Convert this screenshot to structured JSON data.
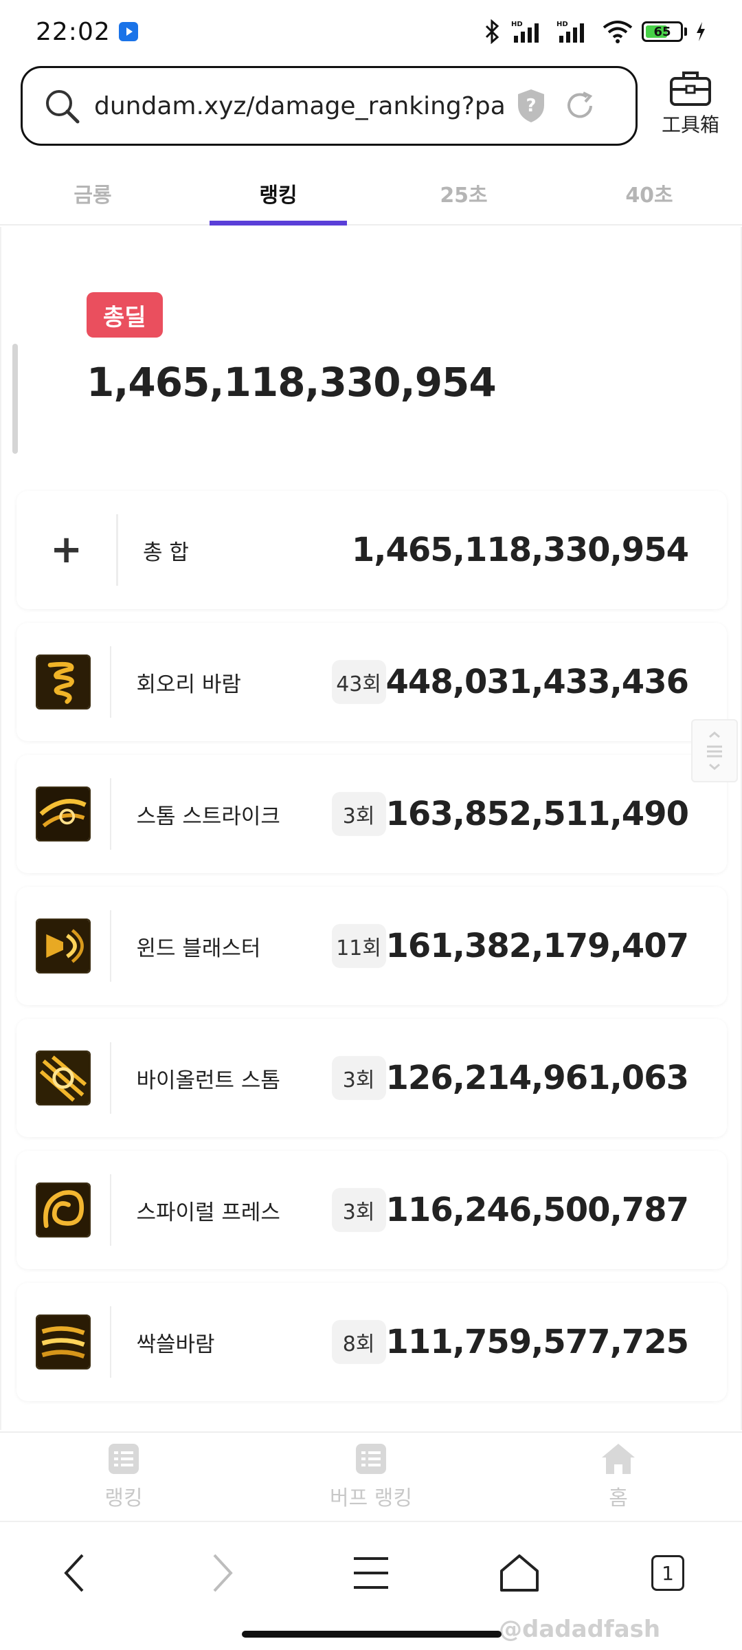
{
  "status_bar": {
    "time": "22:02",
    "battery": "65"
  },
  "browser": {
    "url": "dundam.xyz/damage_ranking?pa...",
    "toolbox_label": "工具箱"
  },
  "tabs": [
    {
      "label": "금룡",
      "active": false
    },
    {
      "label": "랭킹",
      "active": true
    },
    {
      "label": "25초",
      "active": false
    },
    {
      "label": "40초",
      "active": false
    }
  ],
  "summary": {
    "badge": "총딜",
    "total": "1,465,118,330,954"
  },
  "total_row": {
    "label": "총 합",
    "damage": "1,465,118,330,954"
  },
  "skills": [
    {
      "name": "회오리 바람",
      "count": "43회",
      "damage": "448,031,433,436",
      "icon": "whirlwind-skill-icon"
    },
    {
      "name": "스톰 스트라이크",
      "count": "3회",
      "damage": "163,852,511,490",
      "icon": "storm-strike-skill-icon"
    },
    {
      "name": "윈드 블래스터",
      "count": "11회",
      "damage": "161,382,179,407",
      "icon": "wind-blaster-skill-icon"
    },
    {
      "name": "바이올런트 스톰",
      "count": "3회",
      "damage": "126,214,961,063",
      "icon": "violent-storm-skill-icon"
    },
    {
      "name": "스파이럴 프레스",
      "count": "3회",
      "damage": "116,246,500,787",
      "icon": "spiral-press-skill-icon"
    },
    {
      "name": "싹쓸바람",
      "count": "8회",
      "damage": "111,759,577,725",
      "icon": "sweeping-wind-skill-icon"
    }
  ],
  "bottom_nav": [
    {
      "label": "랭킹",
      "icon": "list-icon"
    },
    {
      "label": "버프 랭킹",
      "icon": "list-icon"
    },
    {
      "label": "홈",
      "icon": "home-icon"
    }
  ],
  "browser_nav": {
    "tab_count": "1"
  },
  "watermark": "@dadadfash",
  "colors": {
    "accent": "#5a3fd8",
    "badge": "#ea4f5e"
  }
}
